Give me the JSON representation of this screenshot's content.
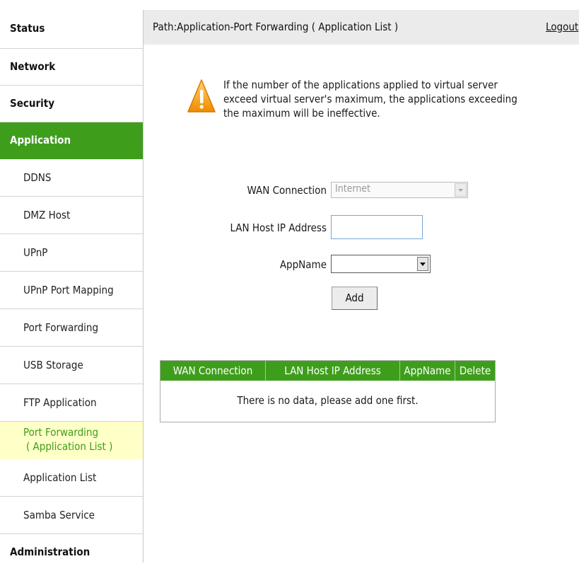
{
  "sidebar": {
    "items": [
      {
        "label": "Status"
      },
      {
        "label": "Network"
      },
      {
        "label": "Security"
      },
      {
        "label": "Application"
      },
      {
        "label": "DDNS"
      },
      {
        "label": "DMZ Host"
      },
      {
        "label": "UPnP"
      },
      {
        "label": "UPnP Port Mapping"
      },
      {
        "label": "Port Forwarding"
      },
      {
        "label": "USB Storage"
      },
      {
        "label": "FTP Application"
      },
      {
        "label_line1": "Port Forwarding",
        "label_line2": "( Application List )"
      },
      {
        "label": "Application List"
      },
      {
        "label": "Samba Service"
      },
      {
        "label": "Administration"
      }
    ]
  },
  "header": {
    "path": "Path:Application-Port Forwarding ( Application List )",
    "logout": "Logout"
  },
  "notice": {
    "icon": "warning-icon",
    "text": "If the number of the applications applied to virtual server exceed virtual server's maximum, the applications exceeding the maximum will be ineffective."
  },
  "form": {
    "wan_label": "WAN Connection",
    "wan_value": "Internet",
    "lan_label": "LAN Host IP Address",
    "lan_value": "",
    "app_label": "AppName",
    "app_value": "",
    "add_label": "Add"
  },
  "table": {
    "headers": [
      "WAN Connection",
      "LAN Host IP Address",
      "AppName",
      "Delete"
    ],
    "empty_text": "There is no data, please add one first."
  },
  "colors": {
    "accent": "#3e9e1c",
    "selected_bg": "#ffffc8",
    "header_bg": "#ebebeb"
  }
}
